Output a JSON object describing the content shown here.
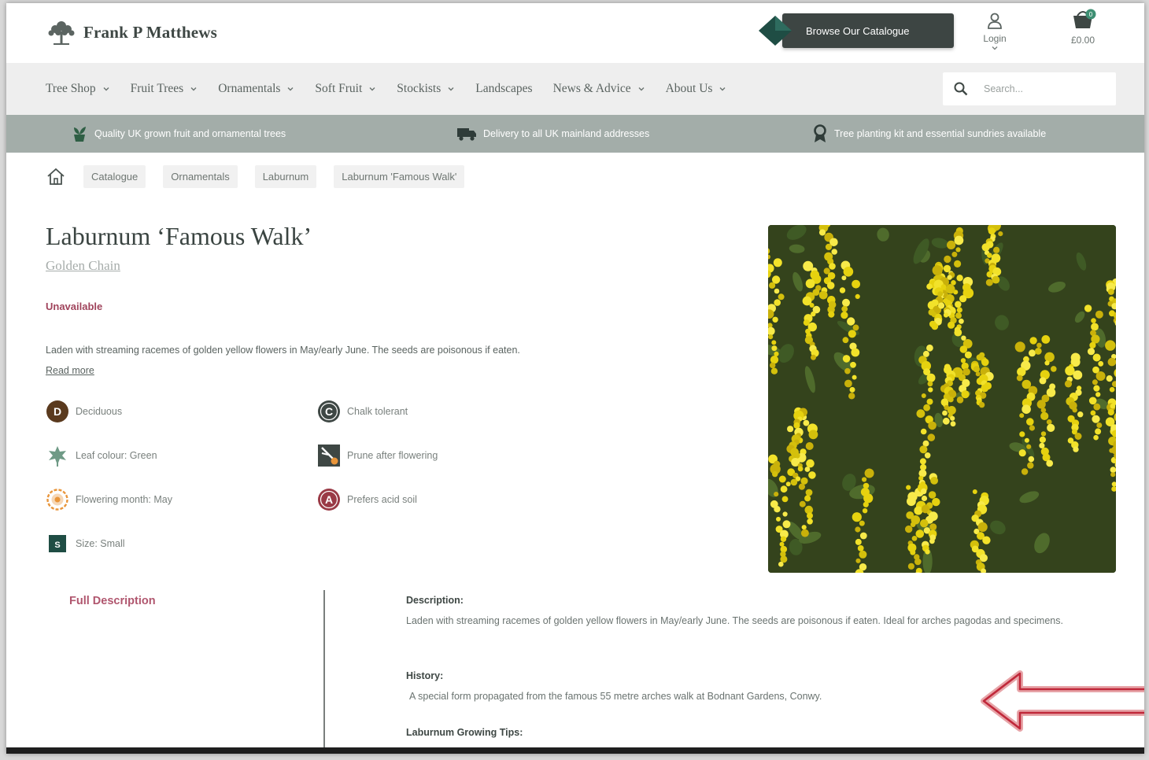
{
  "header": {
    "logo_text": "Frank P Matthews",
    "browse_button": "Browse Our Catalogue",
    "login_label": "Login",
    "cart_total": "£0.00",
    "cart_count": "0"
  },
  "nav": {
    "items": [
      {
        "label": "Tree Shop",
        "has_dropdown": true
      },
      {
        "label": "Fruit Trees",
        "has_dropdown": true
      },
      {
        "label": "Ornamentals",
        "has_dropdown": true
      },
      {
        "label": "Soft Fruit",
        "has_dropdown": true
      },
      {
        "label": "Stockists",
        "has_dropdown": true
      },
      {
        "label": "Landscapes",
        "has_dropdown": false
      },
      {
        "label": "News & Advice",
        "has_dropdown": true
      },
      {
        "label": "About Us",
        "has_dropdown": true
      }
    ],
    "search_placeholder": "Search..."
  },
  "banner": {
    "items": [
      {
        "icon": "plant-pot-icon",
        "text": "Quality UK grown fruit and ornamental trees"
      },
      {
        "icon": "delivery-truck-icon",
        "text": "Delivery to all UK mainland addresses"
      },
      {
        "icon": "award-ribbon-icon",
        "text": "Tree planting kit and essential sundries available"
      }
    ]
  },
  "breadcrumb": {
    "items": [
      "Catalogue",
      "Ornamentals",
      "Laburnum",
      "Laburnum 'Famous Walk'"
    ]
  },
  "product": {
    "title": "Laburnum ‘Famous Walk’",
    "common_name": "Golden Chain",
    "status": "Unavailable",
    "intro": "Laden with streaming racemes of golden yellow flowers in May/early June. The seeds are poisonous if eaten.",
    "read_more": "Read more",
    "attributes": [
      {
        "icon_letter": "D",
        "text": "Deciduous"
      },
      {
        "icon_letter": "C",
        "text": "Chalk tolerant"
      },
      {
        "icon_letter": "",
        "text": "Leaf colour: Green"
      },
      {
        "icon_letter": "",
        "text": "Prune after flowering"
      },
      {
        "icon_letter": "",
        "text": "Flowering month: May"
      },
      {
        "icon_letter": "A",
        "text": "Prefers acid soil"
      },
      {
        "icon_letter": "S",
        "text": "Size: Small"
      }
    ]
  },
  "description": {
    "tab_label": "Full Description",
    "sections": [
      {
        "heading": "Description:",
        "text": "Laden with streaming racemes of golden yellow flowers in May/early June. The seeds are poisonous if eaten. Ideal for arches pagodas and specimens."
      },
      {
        "heading": "History:",
        "text": "A special form propagated from the famous 55 metre arches walk at Bodnant Gardens, Conwy."
      },
      {
        "heading": "Laburnum Growing Tips:",
        "text": ""
      }
    ]
  },
  "colors": {
    "accent": "#a0445c",
    "banner": "#a3ada9",
    "nav_bg": "#eeeeee",
    "dark_button": "#3d4543"
  }
}
